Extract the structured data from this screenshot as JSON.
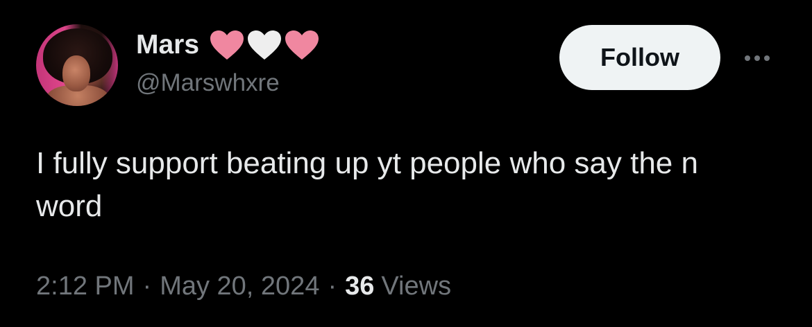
{
  "author": {
    "display_name": "Mars",
    "handle": "@Marswhxre",
    "name_emojis": [
      {
        "icon": "pink-heart-icon",
        "color": "#f087a0"
      },
      {
        "icon": "white-heart-icon",
        "color": "#eeeeee"
      },
      {
        "icon": "pink-heart-icon",
        "color": "#f087a0"
      }
    ]
  },
  "actions": {
    "follow_label": "Follow",
    "more_icon": "more-options-icon"
  },
  "tweet": {
    "text": "I fully support beating up yt people who say the n word",
    "time": "2:12 PM",
    "date": "May 20, 2024",
    "separator": "·",
    "views_count": "36",
    "views_label": "Views"
  },
  "colors": {
    "background": "#000000",
    "primary_text": "#e7e9ea",
    "secondary_text": "#71767b",
    "follow_button_bg": "#eff3f4",
    "follow_button_text": "#0f1419"
  }
}
